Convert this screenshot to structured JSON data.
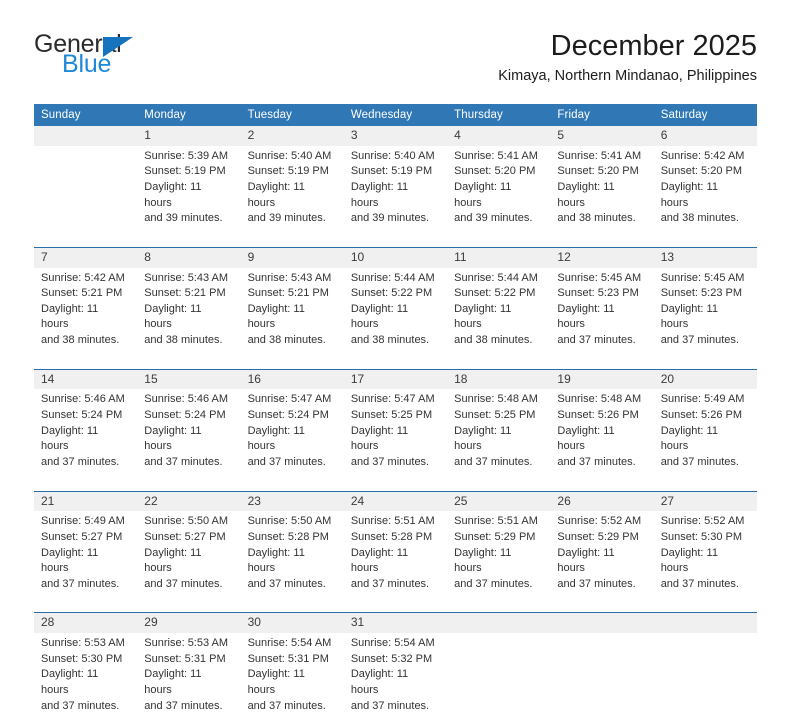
{
  "brand": {
    "name_top": "General",
    "name_bottom": "Blue",
    "triangle_color": "#1673be",
    "blue_color": "#1e88d6"
  },
  "header": {
    "title": "December 2025",
    "location": "Kimaya, Northern Mindanao, Philippines"
  },
  "theme": {
    "header_blue": "#3077b6",
    "row_rule_blue": "#2b6cad",
    "day_strip_gray": "#f0f0f0"
  },
  "calendar": {
    "weekday_headers": [
      "Sunday",
      "Monday",
      "Tuesday",
      "Wednesday",
      "Thursday",
      "Friday",
      "Saturday"
    ],
    "weeks": [
      [
        {
          "day": "",
          "sunrise": "",
          "sunset": "",
          "daylight_line1": "",
          "daylight_line2": ""
        },
        {
          "day": "1",
          "sunrise": "Sunrise: 5:39 AM",
          "sunset": "Sunset: 5:19 PM",
          "daylight_line1": "Daylight: 11 hours",
          "daylight_line2": "and 39 minutes."
        },
        {
          "day": "2",
          "sunrise": "Sunrise: 5:40 AM",
          "sunset": "Sunset: 5:19 PM",
          "daylight_line1": "Daylight: 11 hours",
          "daylight_line2": "and 39 minutes."
        },
        {
          "day": "3",
          "sunrise": "Sunrise: 5:40 AM",
          "sunset": "Sunset: 5:19 PM",
          "daylight_line1": "Daylight: 11 hours",
          "daylight_line2": "and 39 minutes."
        },
        {
          "day": "4",
          "sunrise": "Sunrise: 5:41 AM",
          "sunset": "Sunset: 5:20 PM",
          "daylight_line1": "Daylight: 11 hours",
          "daylight_line2": "and 39 minutes."
        },
        {
          "day": "5",
          "sunrise": "Sunrise: 5:41 AM",
          "sunset": "Sunset: 5:20 PM",
          "daylight_line1": "Daylight: 11 hours",
          "daylight_line2": "and 38 minutes."
        },
        {
          "day": "6",
          "sunrise": "Sunrise: 5:42 AM",
          "sunset": "Sunset: 5:20 PM",
          "daylight_line1": "Daylight: 11 hours",
          "daylight_line2": "and 38 minutes."
        }
      ],
      [
        {
          "day": "7",
          "sunrise": "Sunrise: 5:42 AM",
          "sunset": "Sunset: 5:21 PM",
          "daylight_line1": "Daylight: 11 hours",
          "daylight_line2": "and 38 minutes."
        },
        {
          "day": "8",
          "sunrise": "Sunrise: 5:43 AM",
          "sunset": "Sunset: 5:21 PM",
          "daylight_line1": "Daylight: 11 hours",
          "daylight_line2": "and 38 minutes."
        },
        {
          "day": "9",
          "sunrise": "Sunrise: 5:43 AM",
          "sunset": "Sunset: 5:21 PM",
          "daylight_line1": "Daylight: 11 hours",
          "daylight_line2": "and 38 minutes."
        },
        {
          "day": "10",
          "sunrise": "Sunrise: 5:44 AM",
          "sunset": "Sunset: 5:22 PM",
          "daylight_line1": "Daylight: 11 hours",
          "daylight_line2": "and 38 minutes."
        },
        {
          "day": "11",
          "sunrise": "Sunrise: 5:44 AM",
          "sunset": "Sunset: 5:22 PM",
          "daylight_line1": "Daylight: 11 hours",
          "daylight_line2": "and 38 minutes."
        },
        {
          "day": "12",
          "sunrise": "Sunrise: 5:45 AM",
          "sunset": "Sunset: 5:23 PM",
          "daylight_line1": "Daylight: 11 hours",
          "daylight_line2": "and 37 minutes."
        },
        {
          "day": "13",
          "sunrise": "Sunrise: 5:45 AM",
          "sunset": "Sunset: 5:23 PM",
          "daylight_line1": "Daylight: 11 hours",
          "daylight_line2": "and 37 minutes."
        }
      ],
      [
        {
          "day": "14",
          "sunrise": "Sunrise: 5:46 AM",
          "sunset": "Sunset: 5:24 PM",
          "daylight_line1": "Daylight: 11 hours",
          "daylight_line2": "and 37 minutes."
        },
        {
          "day": "15",
          "sunrise": "Sunrise: 5:46 AM",
          "sunset": "Sunset: 5:24 PM",
          "daylight_line1": "Daylight: 11 hours",
          "daylight_line2": "and 37 minutes."
        },
        {
          "day": "16",
          "sunrise": "Sunrise: 5:47 AM",
          "sunset": "Sunset: 5:24 PM",
          "daylight_line1": "Daylight: 11 hours",
          "daylight_line2": "and 37 minutes."
        },
        {
          "day": "17",
          "sunrise": "Sunrise: 5:47 AM",
          "sunset": "Sunset: 5:25 PM",
          "daylight_line1": "Daylight: 11 hours",
          "daylight_line2": "and 37 minutes."
        },
        {
          "day": "18",
          "sunrise": "Sunrise: 5:48 AM",
          "sunset": "Sunset: 5:25 PM",
          "daylight_line1": "Daylight: 11 hours",
          "daylight_line2": "and 37 minutes."
        },
        {
          "day": "19",
          "sunrise": "Sunrise: 5:48 AM",
          "sunset": "Sunset: 5:26 PM",
          "daylight_line1": "Daylight: 11 hours",
          "daylight_line2": "and 37 minutes."
        },
        {
          "day": "20",
          "sunrise": "Sunrise: 5:49 AM",
          "sunset": "Sunset: 5:26 PM",
          "daylight_line1": "Daylight: 11 hours",
          "daylight_line2": "and 37 minutes."
        }
      ],
      [
        {
          "day": "21",
          "sunrise": "Sunrise: 5:49 AM",
          "sunset": "Sunset: 5:27 PM",
          "daylight_line1": "Daylight: 11 hours",
          "daylight_line2": "and 37 minutes."
        },
        {
          "day": "22",
          "sunrise": "Sunrise: 5:50 AM",
          "sunset": "Sunset: 5:27 PM",
          "daylight_line1": "Daylight: 11 hours",
          "daylight_line2": "and 37 minutes."
        },
        {
          "day": "23",
          "sunrise": "Sunrise: 5:50 AM",
          "sunset": "Sunset: 5:28 PM",
          "daylight_line1": "Daylight: 11 hours",
          "daylight_line2": "and 37 minutes."
        },
        {
          "day": "24",
          "sunrise": "Sunrise: 5:51 AM",
          "sunset": "Sunset: 5:28 PM",
          "daylight_line1": "Daylight: 11 hours",
          "daylight_line2": "and 37 minutes."
        },
        {
          "day": "25",
          "sunrise": "Sunrise: 5:51 AM",
          "sunset": "Sunset: 5:29 PM",
          "daylight_line1": "Daylight: 11 hours",
          "daylight_line2": "and 37 minutes."
        },
        {
          "day": "26",
          "sunrise": "Sunrise: 5:52 AM",
          "sunset": "Sunset: 5:29 PM",
          "daylight_line1": "Daylight: 11 hours",
          "daylight_line2": "and 37 minutes."
        },
        {
          "day": "27",
          "sunrise": "Sunrise: 5:52 AM",
          "sunset": "Sunset: 5:30 PM",
          "daylight_line1": "Daylight: 11 hours",
          "daylight_line2": "and 37 minutes."
        }
      ],
      [
        {
          "day": "28",
          "sunrise": "Sunrise: 5:53 AM",
          "sunset": "Sunset: 5:30 PM",
          "daylight_line1": "Daylight: 11 hours",
          "daylight_line2": "and 37 minutes."
        },
        {
          "day": "29",
          "sunrise": "Sunrise: 5:53 AM",
          "sunset": "Sunset: 5:31 PM",
          "daylight_line1": "Daylight: 11 hours",
          "daylight_line2": "and 37 minutes."
        },
        {
          "day": "30",
          "sunrise": "Sunrise: 5:54 AM",
          "sunset": "Sunset: 5:31 PM",
          "daylight_line1": "Daylight: 11 hours",
          "daylight_line2": "and 37 minutes."
        },
        {
          "day": "31",
          "sunrise": "Sunrise: 5:54 AM",
          "sunset": "Sunset: 5:32 PM",
          "daylight_line1": "Daylight: 11 hours",
          "daylight_line2": "and 37 minutes."
        },
        {
          "day": "",
          "sunrise": "",
          "sunset": "",
          "daylight_line1": "",
          "daylight_line2": ""
        },
        {
          "day": "",
          "sunrise": "",
          "sunset": "",
          "daylight_line1": "",
          "daylight_line2": ""
        },
        {
          "day": "",
          "sunrise": "",
          "sunset": "",
          "daylight_line1": "",
          "daylight_line2": ""
        }
      ]
    ]
  }
}
